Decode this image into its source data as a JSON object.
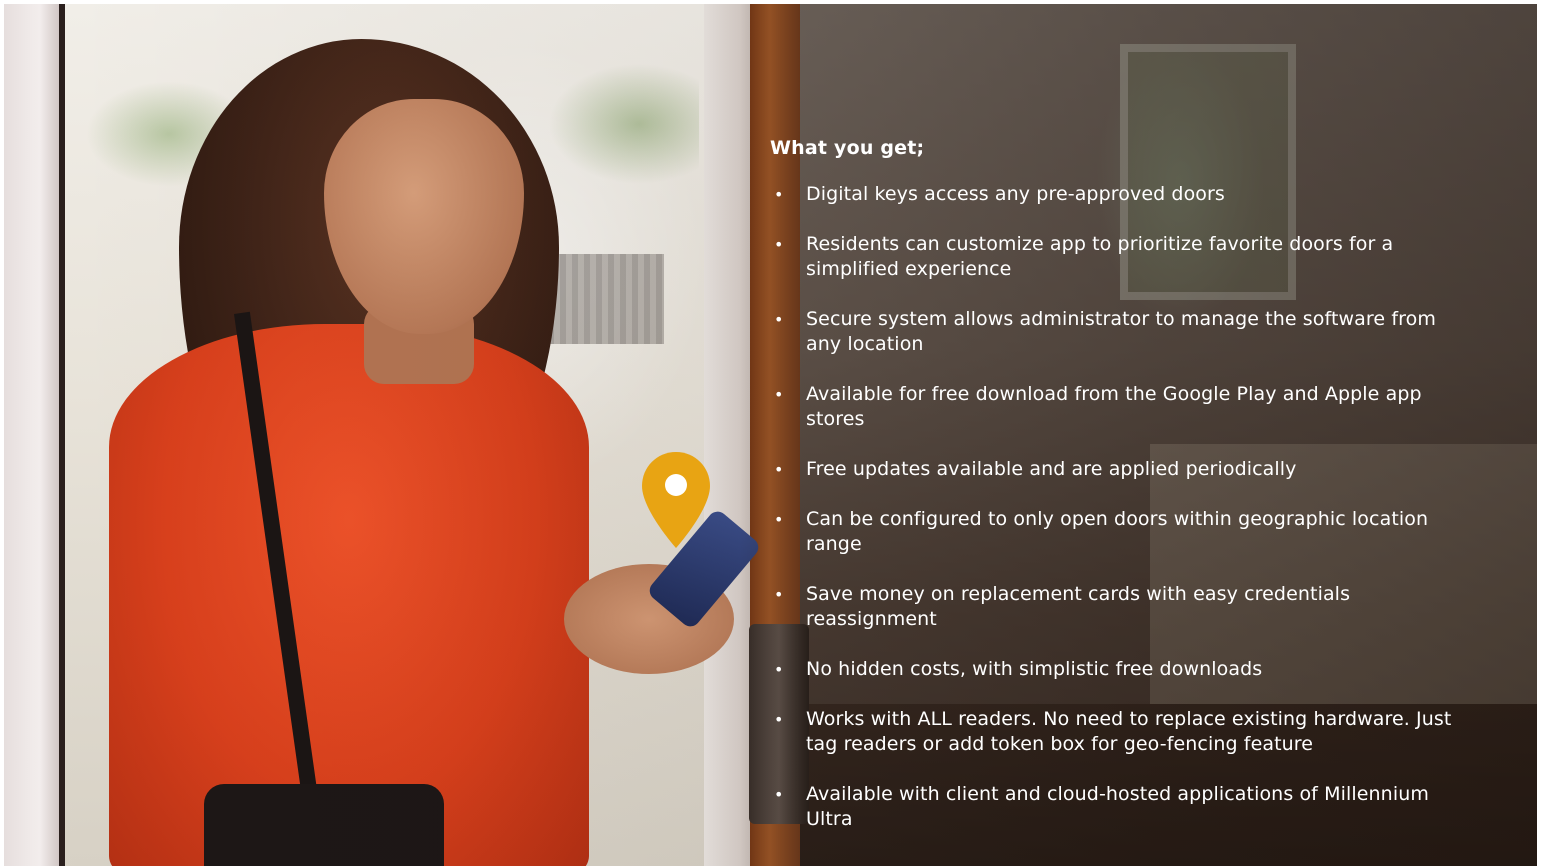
{
  "slide": {
    "heading": "What you get;",
    "bullet_symbol": "•",
    "bullets": [
      {
        "text": "Digital keys access any pre-approved doors"
      },
      {
        "text": "Residents can customize app to prioritize favorite doors for a simplified experience"
      },
      {
        "text": "Secure system allows administrator to manage the software from any location"
      },
      {
        "text": "Available for free download from the Google Play and Apple app stores"
      },
      {
        "text": "Free updates available and are applied periodically"
      },
      {
        "text": "Can be configured to only open doors within geographic location range"
      },
      {
        "text": "Save money on replacement cards with easy credentials reassignment"
      },
      {
        "text": "No hidden costs, with simplistic free downloads"
      },
      {
        "text": "Works with ALL readers. No need to replace existing hardware. Just tag readers or add token box for geo-fencing feature"
      },
      {
        "text": "Available with client and cloud-hosted applications of Millennium Ultra"
      }
    ]
  },
  "icons": {
    "pin": "location-pin-icon"
  },
  "colors": {
    "text": "#ffffff",
    "pin_accent": "#e8a413",
    "shirt": "#d9401c",
    "door_wood": "#a0562a"
  }
}
